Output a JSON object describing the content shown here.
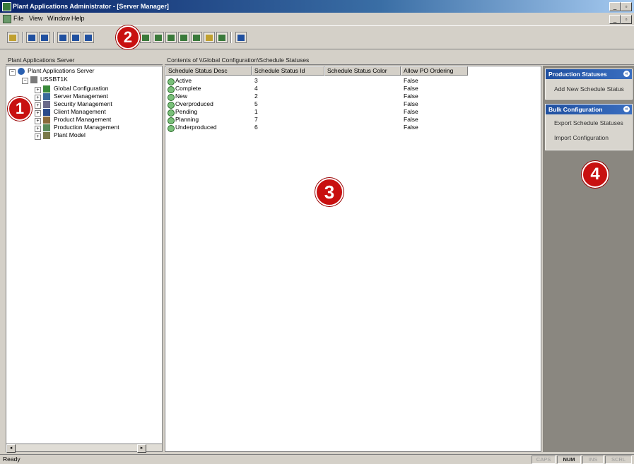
{
  "window": {
    "title": "Plant Applications Administrator - [Server Manager]",
    "minimize_label": "_",
    "maximize_label": "▫",
    "close_label": "×"
  },
  "menu": {
    "items": [
      "File",
      "View",
      "Window",
      "Help"
    ]
  },
  "toolbar": {
    "buttons": [
      "open-icon",
      "tree-icon",
      "list-icon",
      "details-icon",
      "window-icon",
      "export-icon",
      "users-icon",
      "security-icon",
      "server-icon",
      "config-icon",
      "model-icon",
      "report-icon",
      "help-icon"
    ]
  },
  "callouts": [
    "1",
    "2",
    "3",
    "4"
  ],
  "tree": {
    "header": "Plant Applications Server",
    "root": "Plant Applications Server",
    "server": "USSBT1K",
    "nodes": [
      "Global Configuration",
      "Server Management",
      "Security Management",
      "Client Management",
      "Product Management",
      "Production Management",
      "Plant Model"
    ]
  },
  "list": {
    "header": "Contents of \\\\Global Configuration\\Schedule Statuses",
    "columns": [
      "Schedule Status Desc",
      "Schedule Status Id",
      "Schedule Status Color",
      "Allow PO Ordering"
    ],
    "rows": [
      {
        "desc": "Active",
        "id": "3",
        "color": "",
        "allow": "False"
      },
      {
        "desc": "Complete",
        "id": "4",
        "color": "",
        "allow": "False"
      },
      {
        "desc": "New",
        "id": "2",
        "color": "",
        "allow": "False"
      },
      {
        "desc": "Overproduced",
        "id": "5",
        "color": "",
        "allow": "False"
      },
      {
        "desc": "Pending",
        "id": "1",
        "color": "",
        "allow": "False"
      },
      {
        "desc": "Planning",
        "id": "7",
        "color": "",
        "allow": "False"
      },
      {
        "desc": "Underproduced",
        "id": "6",
        "color": "",
        "allow": "False"
      }
    ]
  },
  "tasks": {
    "groups": [
      {
        "title": "Production Statuses",
        "links": [
          "Add New Schedule Status"
        ]
      },
      {
        "title": "Bulk Configuration",
        "links": [
          "Export Schedule Statuses",
          "Import Configuration"
        ]
      }
    ]
  },
  "status": {
    "text": "Ready",
    "indicators": [
      "CAPS",
      "NUM",
      "INS",
      "SCRL"
    ]
  },
  "colors": {
    "callout": "#c81010",
    "task_header": "#2050a0",
    "title_bar": "#0a246a"
  }
}
